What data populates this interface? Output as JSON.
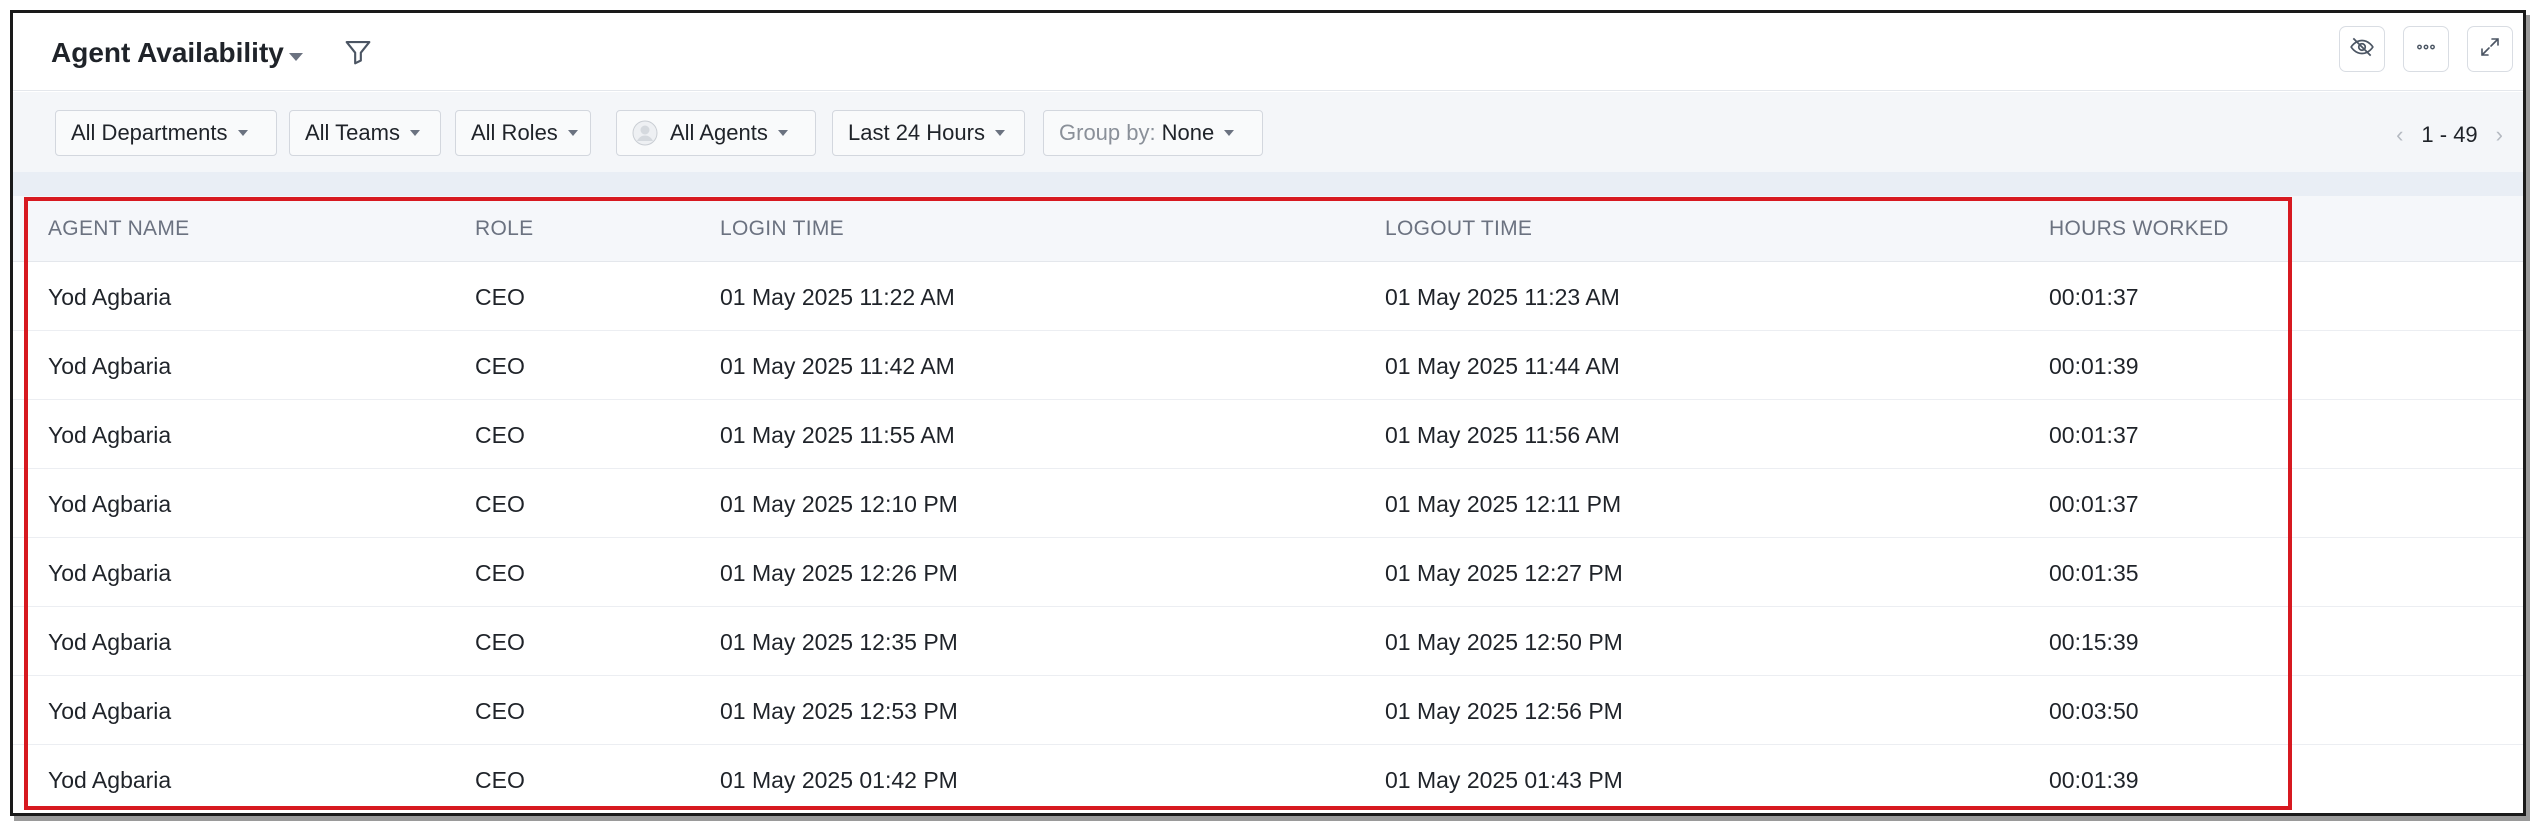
{
  "header": {
    "title": "Agent Availability",
    "title_dropdown_icon": "caret-down-icon",
    "filter_icon": "funnel-icon",
    "tools": [
      "eye-off-icon",
      "more-horizontal-icon",
      "expand-icon"
    ]
  },
  "filters": {
    "department": "All Departments",
    "teams": "All Teams",
    "roles": "All Roles",
    "agents": "All Agents",
    "date_range": "Last 24 Hours",
    "group_by_label": "Group by:",
    "group_by_value": "None"
  },
  "pagination": {
    "range": "1 - 49",
    "prev_icon": "chevron-left-icon",
    "next_icon": "chevron-right-icon"
  },
  "table": {
    "columns": [
      "AGENT NAME",
      "ROLE",
      "LOGIN TIME",
      "LOGOUT TIME",
      "HOURS WORKED"
    ],
    "rows": [
      [
        "Yod Agbaria",
        "CEO",
        "01 May 2025 11:22 AM",
        "01 May 2025 11:23 AM",
        "00:01:37"
      ],
      [
        "Yod Agbaria",
        "CEO",
        "01 May 2025 11:42 AM",
        "01 May 2025 11:44 AM",
        "00:01:39"
      ],
      [
        "Yod Agbaria",
        "CEO",
        "01 May 2025 11:55 AM",
        "01 May 2025 11:56 AM",
        "00:01:37"
      ],
      [
        "Yod Agbaria",
        "CEO",
        "01 May 2025 12:10 PM",
        "01 May 2025 12:11 PM",
        "00:01:37"
      ],
      [
        "Yod Agbaria",
        "CEO",
        "01 May 2025 12:26 PM",
        "01 May 2025 12:27 PM",
        "00:01:35"
      ],
      [
        "Yod Agbaria",
        "CEO",
        "01 May 2025 12:35 PM",
        "01 May 2025 12:50 PM",
        "00:15:39"
      ],
      [
        "Yod Agbaria",
        "CEO",
        "01 May 2025 12:53 PM",
        "01 May 2025 12:56 PM",
        "00:03:50"
      ],
      [
        "Yod Agbaria",
        "CEO",
        "01 May 2025 01:42 PM",
        "01 May 2025 01:43 PM",
        "00:01:39"
      ]
    ]
  },
  "colors": {
    "highlight_border": "#d71920",
    "filter_bar_bg": "#f4f6f9",
    "header_text_muted": "#6b7280"
  }
}
